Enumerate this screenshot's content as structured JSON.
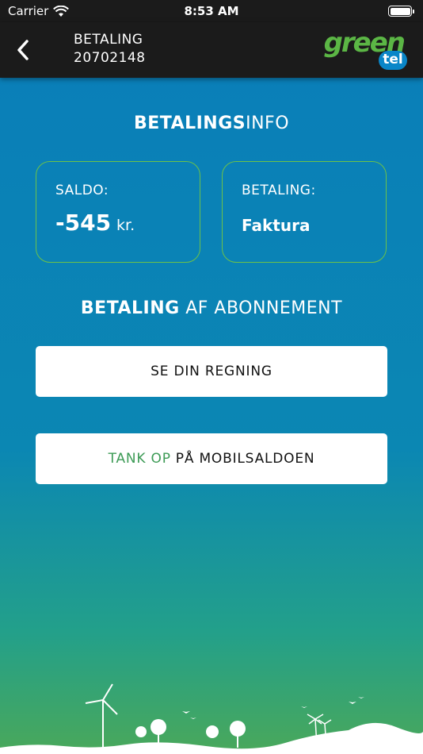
{
  "status_bar": {
    "carrier": "Carrier",
    "time": "8:53 AM"
  },
  "nav": {
    "title": "BETALING",
    "subtitle": "20702148",
    "logo_top": "green",
    "logo_bottom": "tel"
  },
  "info": {
    "title_bold": "BETALINGS",
    "title_rest": "INFO",
    "saldo_label": "SALDO:",
    "saldo_value": "-545",
    "saldo_unit": "kr.",
    "payment_label": "BETALING:",
    "payment_value": "Faktura"
  },
  "subscription": {
    "title_bold": "BETALING",
    "title_rest": "AF ABONNEMENT",
    "bill_button": "SE DIN REGNING",
    "topup_green": "TANK OP",
    "topup_rest": "PÅ MOBILSALDOEN"
  },
  "colors": {
    "accent_green": "#6cc24a",
    "background_blue": "#0a7fb8",
    "bar": "#1b1b1b"
  }
}
